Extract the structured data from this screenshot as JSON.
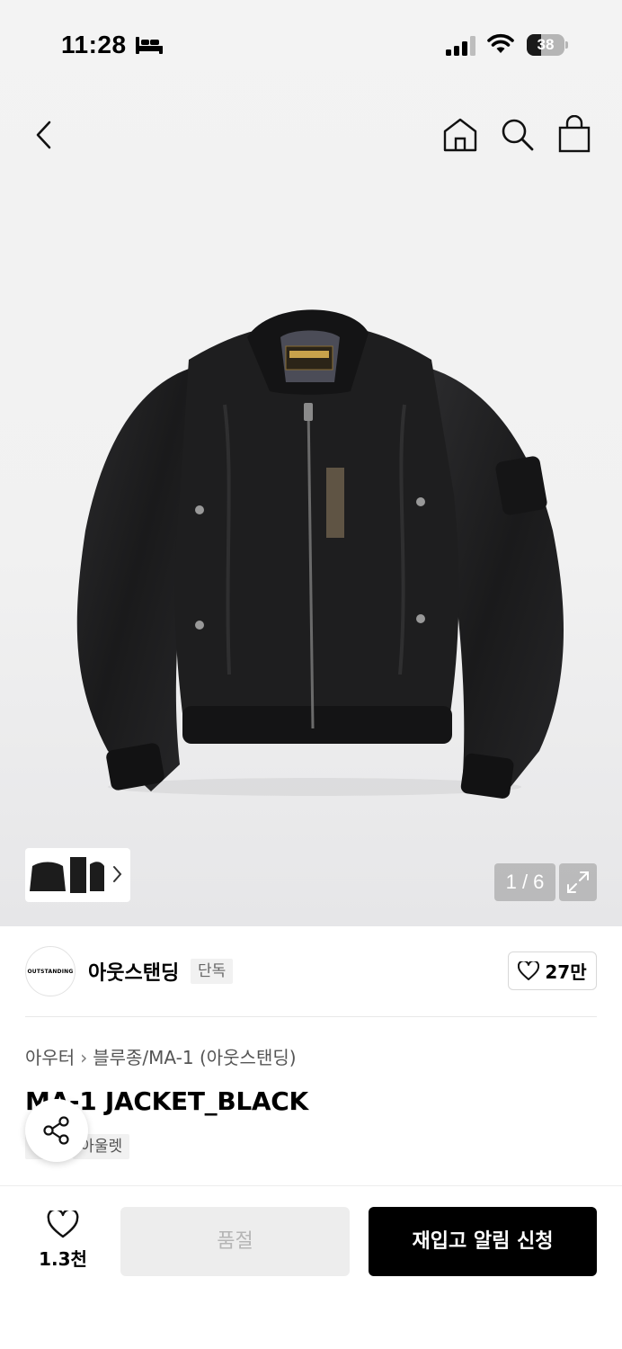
{
  "status_bar": {
    "time": "11:28",
    "battery": "38",
    "battery_level": 0.38
  },
  "nav": {
    "back_icon": "chevron-left-icon",
    "home_icon": "home-icon",
    "search_icon": "search-icon",
    "cart_icon": "shopping-bag-icon"
  },
  "gallery": {
    "counter": "1 / 6",
    "current": 1,
    "total": 6
  },
  "brand": {
    "logo_text": "OUTSTANDING",
    "name": "아웃스탠딩",
    "tag": "단독",
    "likes": "27만"
  },
  "product": {
    "category": "아우터",
    "subcategory": "블루종/MA-1 (아웃스탠딩)",
    "title": "MA-1 JACKET_BLACK",
    "tags": [
      "단독",
      "아울렛"
    ]
  },
  "bottom_bar": {
    "wish_count": "1.3천",
    "soldout_label": "품절",
    "restock_label": "재입고 알림 신청"
  }
}
